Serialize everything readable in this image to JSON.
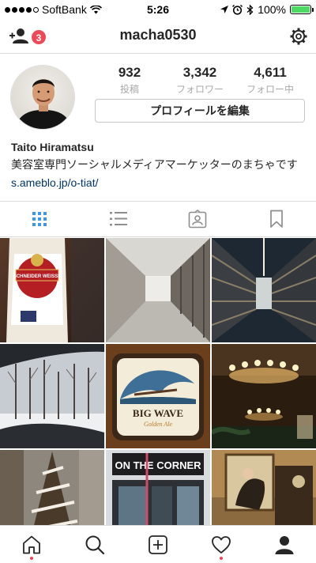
{
  "status_bar": {
    "carrier": "SoftBank",
    "time": "5:26",
    "battery_percent": "100%",
    "battery_level": 1.0
  },
  "header": {
    "username": "macha0530",
    "notification_count": "3",
    "icons": [
      "add-user-icon",
      "gear-icon"
    ]
  },
  "profile": {
    "stats": [
      {
        "value": "932",
        "label": "投稿"
      },
      {
        "value": "3,342",
        "label": "フォロワー"
      },
      {
        "value": "4,611",
        "label": "フォロー中"
      }
    ],
    "edit_button_label": "プロフィールを編集",
    "name": "Taito Hiramatsu",
    "bio": "美容室専門ソーシャルメディアマーケッターのまちゃです",
    "link": "s.ameblo.jp/o-tiat/"
  },
  "tabs": [
    "grid-icon",
    "list-icon",
    "tagged-icon",
    "bookmark-icon"
  ],
  "posts": [
    {
      "subject": "beer-bottle-photo",
      "label": "SCHNEIDER WEISSE"
    },
    {
      "subject": "hallway-photo"
    },
    {
      "subject": "archive-shelves-photo"
    },
    {
      "subject": "snowy-trees-photo"
    },
    {
      "subject": "big-wave-sign-photo",
      "label": "BIG WAVE",
      "sublabel": "Golden Ale"
    },
    {
      "subject": "chandelier-photo"
    },
    {
      "subject": "christmas-tree-photo"
    },
    {
      "subject": "on-the-corner-photo",
      "label": "ON THE CORNER"
    },
    {
      "subject": "restaurant-photo"
    }
  ],
  "bottom_nav": [
    "home-icon",
    "search-icon",
    "add-post-icon",
    "activity-icon",
    "profile-icon"
  ],
  "colors": {
    "accent_red": "#ed4956",
    "active_blue": "#3897f0",
    "link": "#003569",
    "battery_green": "#4cd964"
  }
}
